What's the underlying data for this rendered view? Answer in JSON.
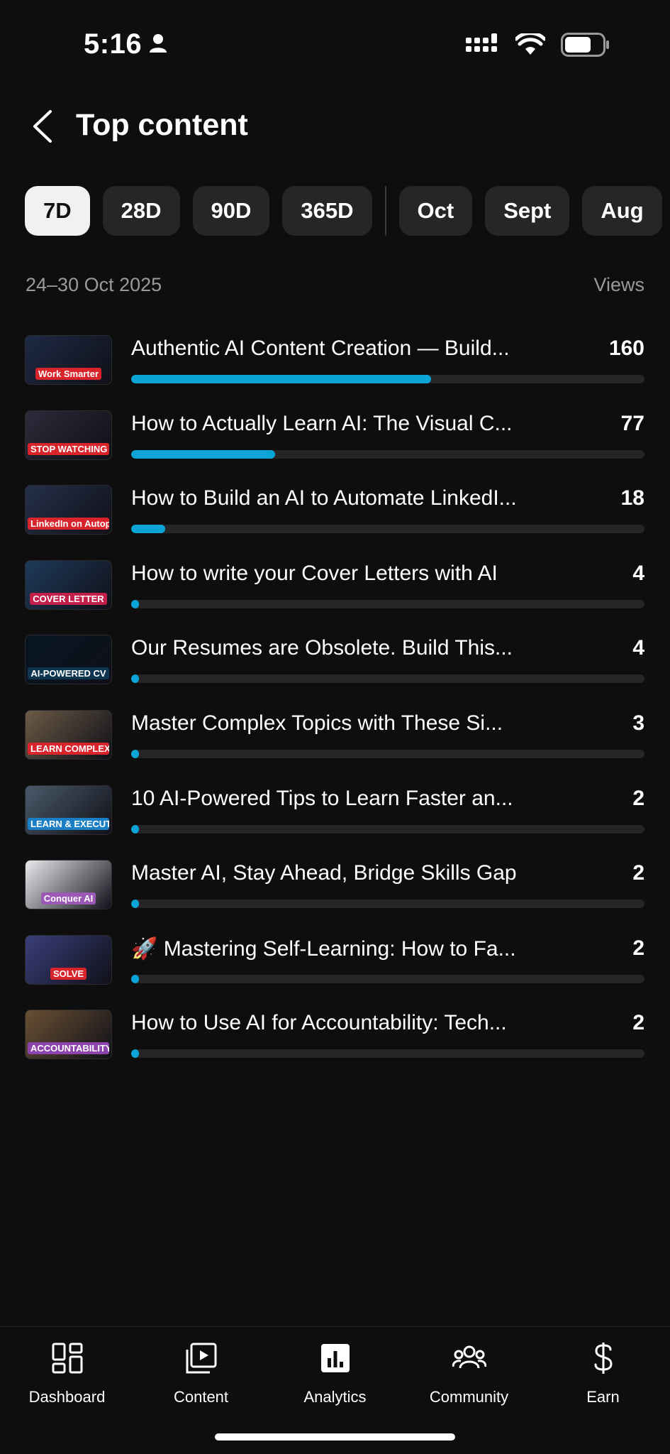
{
  "status_bar": {
    "time": "5:16"
  },
  "header": {
    "title": "Top content"
  },
  "filters": [
    {
      "label": "7D",
      "active": true
    },
    {
      "label": "28D",
      "active": false
    },
    {
      "label": "90D",
      "active": false
    },
    {
      "label": "365D",
      "active": false
    },
    {
      "label": "Oct",
      "active": false
    },
    {
      "label": "Sept",
      "active": false
    },
    {
      "label": "Aug",
      "active": false
    }
  ],
  "range": {
    "dates": "24–30 Oct 2025",
    "column_label": "Views"
  },
  "accent_color": "#0aa4d6",
  "items": [
    {
      "title": "Authentic AI Content Creation — Build...",
      "views": "160",
      "progress": 0.584,
      "thumb_text": "Work Smarter",
      "thumb_bg": "#1d2a44",
      "thumb_tag": "#d8242a"
    },
    {
      "title": "How to Actually Learn AI: The Visual C...",
      "views": "77",
      "progress": 0.281,
      "thumb_text": "STOP WATCHING",
      "thumb_bg": "#2b2b3a",
      "thumb_tag": "#d8242a"
    },
    {
      "title": "How to Build an AI to Automate LinkedI...",
      "views": "18",
      "progress": 0.066,
      "thumb_text": "LinkedIn on Autopilot",
      "thumb_bg": "#24304a",
      "thumb_tag": "#d8242a"
    },
    {
      "title": "How to write your Cover Letters with AI",
      "views": "4",
      "progress": 0.015,
      "thumb_text": "COVER LETTER",
      "thumb_bg": "#1e3a5a",
      "thumb_tag": "#c21f4b"
    },
    {
      "title": "Our Resumes are Obsolete. Build This...",
      "views": "4",
      "progress": 0.015,
      "thumb_text": "AI-POWERED CV",
      "thumb_bg": "#061522",
      "thumb_tag": "#0e3550"
    },
    {
      "title": "Master Complex Topics with These Si...",
      "views": "3",
      "progress": 0.011,
      "thumb_text": "LEARN COMPLEX",
      "thumb_bg": "#6b5a46",
      "thumb_tag": "#d8242a"
    },
    {
      "title": "10 AI-Powered Tips to Learn Faster an...",
      "views": "2",
      "progress": 0.008,
      "thumb_text": "LEARN & EXECUTE",
      "thumb_bg": "#4a5a6a",
      "thumb_tag": "#1a7fc4"
    },
    {
      "title": "Master AI, Stay Ahead, Bridge Skills Gap",
      "views": "2",
      "progress": 0.008,
      "thumb_text": "Conquer AI",
      "thumb_bg": "#e9e9ee",
      "thumb_tag": "#9b59b6"
    },
    {
      "title": "🚀 Mastering Self-Learning: How to Fa...",
      "views": "2",
      "progress": 0.008,
      "thumb_text": "SOLVE",
      "thumb_bg": "#3a3f7a",
      "thumb_tag": "#d8242a"
    },
    {
      "title": "How to Use AI for Accountability: Tech...",
      "views": "2",
      "progress": 0.008,
      "thumb_text": "ACCOUNTABILITY",
      "thumb_bg": "#6a5034",
      "thumb_tag": "#8e44ad"
    }
  ],
  "nav": [
    {
      "label": "Dashboard",
      "icon": "dashboard-icon"
    },
    {
      "label": "Content",
      "icon": "content-icon"
    },
    {
      "label": "Analytics",
      "icon": "analytics-icon"
    },
    {
      "label": "Community",
      "icon": "community-icon"
    },
    {
      "label": "Earn",
      "icon": "earn-icon"
    }
  ]
}
